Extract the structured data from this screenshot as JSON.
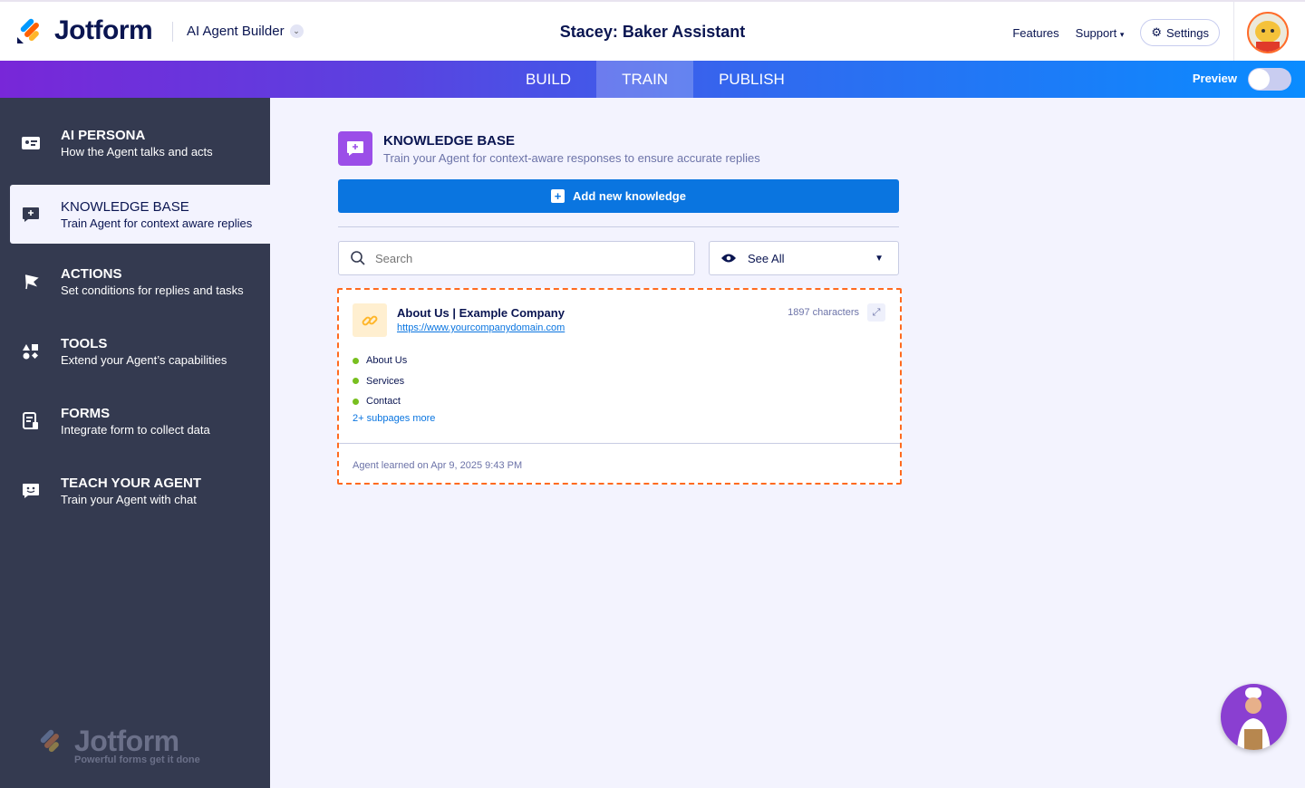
{
  "header": {
    "brand": "Jotform",
    "product": "AI Agent Builder",
    "title": "Stacey: Baker Assistant",
    "features": "Features",
    "support": "Support",
    "settings": "Settings"
  },
  "tabs": [
    "BUILD",
    "TRAIN",
    "PUBLISH"
  ],
  "preview": "Preview",
  "preview_on": false,
  "sidebar": [
    {
      "title": "AI PERSONA",
      "sub": "How the Agent talks and acts"
    },
    {
      "title": "KNOWLEDGE BASE",
      "sub": "Train Agent for context aware replies"
    },
    {
      "title": "ACTIONS",
      "sub": "Set conditions for replies and tasks"
    },
    {
      "title": "TOOLS",
      "sub": "Extend your Agent’s capabilities"
    },
    {
      "title": "FORMS",
      "sub": "Integrate form to collect data"
    },
    {
      "title": "TEACH YOUR AGENT",
      "sub": "Train your Agent with chat"
    }
  ],
  "footer": {
    "brand": "Jotform",
    "tagline": "Powerful forms get it done"
  },
  "kb": {
    "title": "KNOWLEDGE BASE",
    "subtitle": "Train your Agent for context-aware responses to ensure accurate replies",
    "add": "Add new knowledge",
    "search_placeholder": "Search",
    "filter": "See All"
  },
  "card": {
    "title": "About Us | Example Company",
    "url": "https://www.yourcompanydomain.com",
    "chars": "1897 characters",
    "pages": [
      "About Us",
      "Services",
      "Contact"
    ],
    "more": "2+ subpages more",
    "learned": "Agent learned on Apr 9, 2025 9:43 PM"
  }
}
